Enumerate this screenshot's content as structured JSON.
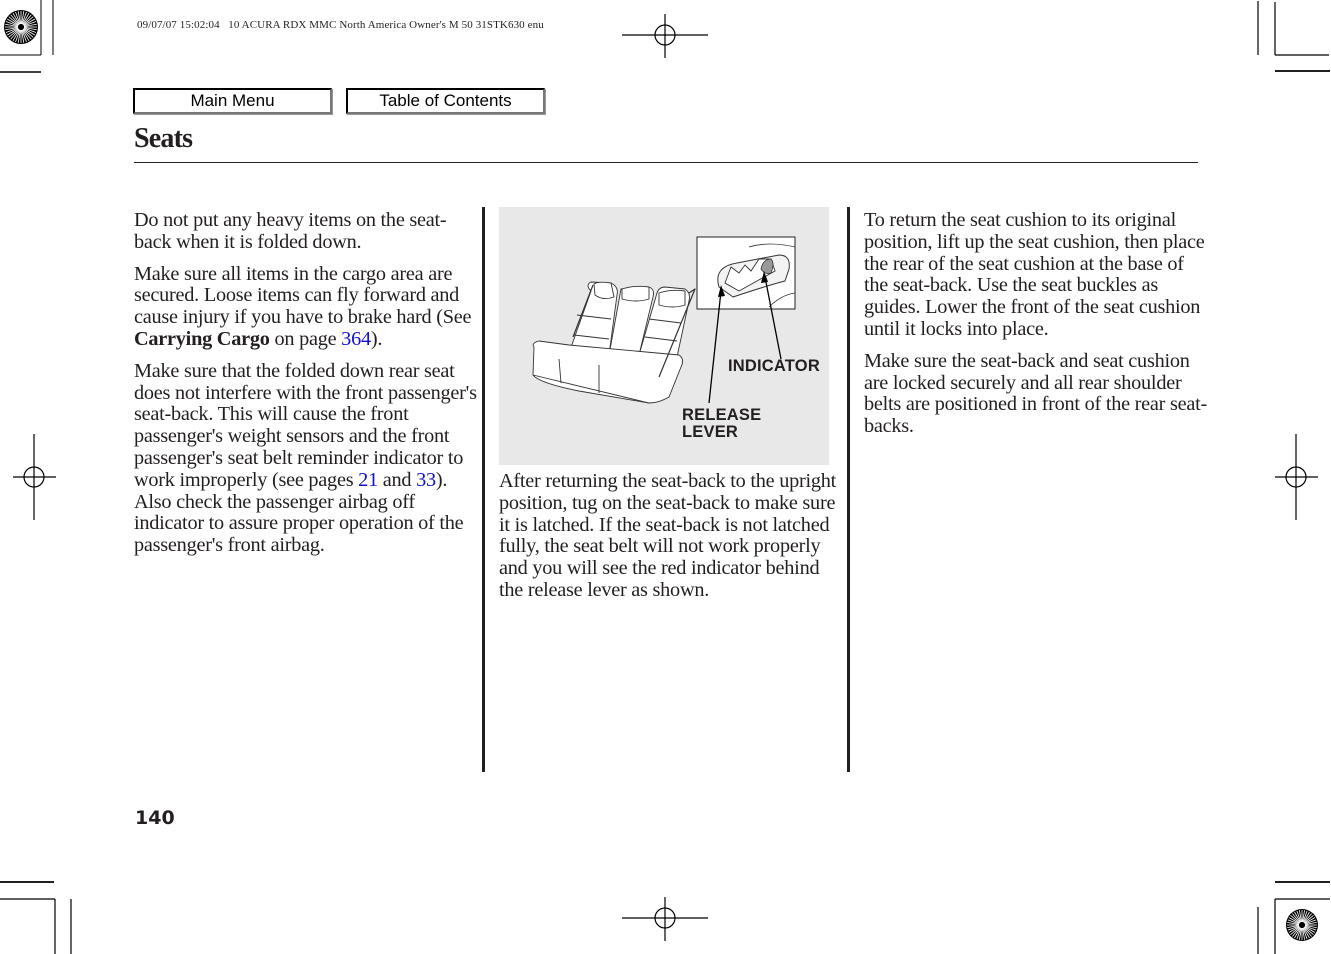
{
  "print_slug": "09/07/07 15:02:04   10 ACURA RDX MMC North America Owner's M 50 31STK630 enu",
  "nav": {
    "main_menu": "Main Menu",
    "table_of_contents": "Table of Contents"
  },
  "page": {
    "title": "Seats",
    "number": "140"
  },
  "column1": {
    "p1": "Do not put any heavy items on the seat-back when it is folded down.",
    "p2_before": "Make sure all items in the cargo area are secured. Loose items can fly forward and cause injury if you have to brake hard (See ",
    "p2_bold": "Carrying Cargo",
    "p2_mid": " on page ",
    "p2_link": "364",
    "p2_after": ").",
    "p3_before": "Make sure that the folded down rear seat does not interfere with the front passenger's seat-back. This will cause the front passenger's weight sensors and the front passenger's seat belt reminder indicator to work improperly (see pages ",
    "p3_link1": "21",
    "p3_mid": " and ",
    "p3_link2": "33",
    "p3_after": "). Also check the passenger airbag off indicator to assure proper operation of the passenger's front airbag."
  },
  "figure": {
    "label_indicator": "INDICATOR",
    "label_release_1": "RELEASE",
    "label_release_2": "LEVER"
  },
  "column2": {
    "p1": "After returning the seat-back to the upright position, tug on the seat-back to make sure it is latched. If the seat-back is not latched fully, the seat belt will not work properly and you will see the red indicator behind the release lever as shown."
  },
  "column3": {
    "p1": "To return the seat cushion to its original position, lift up the seat cushion, then place the rear of the seat cushion at the base of the seat-back. Use the seat buckles as guides. Lower the front of the seat cushion until it locks into place.",
    "p2": "Make sure the seat-back and seat cushion are locked securely and all rear shoulder belts are positioned in front of the rear seat-backs."
  },
  "colors": {
    "link": "#1010d8",
    "text": "#231f20",
    "figure_bg": "#e8e8e8"
  }
}
